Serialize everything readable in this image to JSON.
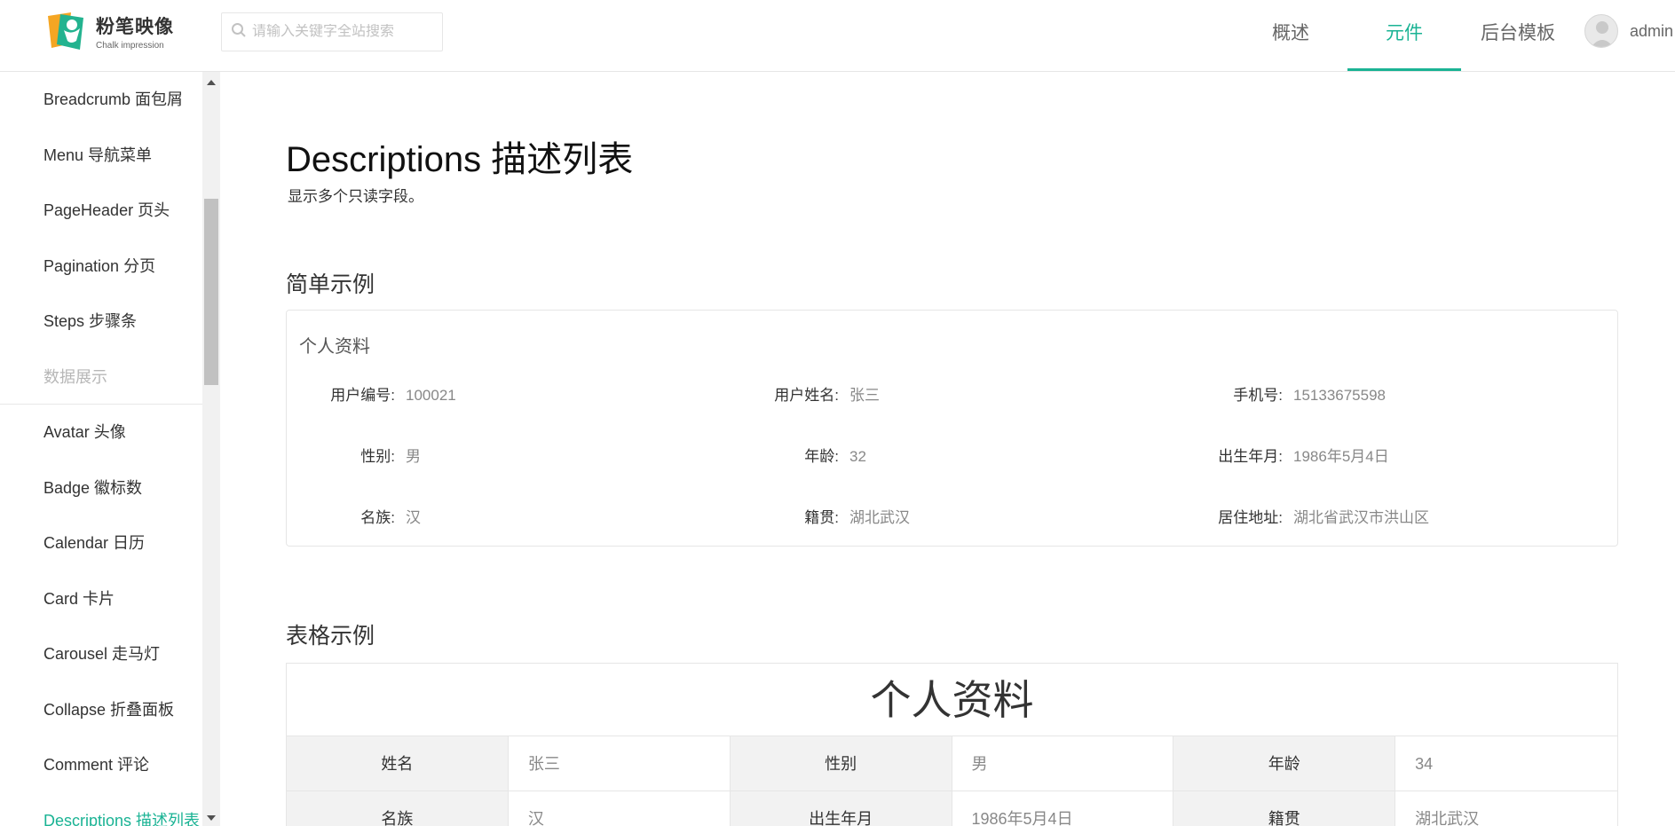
{
  "brand": {
    "title": "粉笔映像",
    "subtitle": "Chalk impression"
  },
  "search": {
    "placeholder": "请输入关键字全站搜索"
  },
  "nav": {
    "items": [
      "概述",
      "元件",
      "后台模板"
    ],
    "active": "元件"
  },
  "user": {
    "name": "admin"
  },
  "sidebar": {
    "items": [
      {
        "label": "Breadcrumb 面包屑"
      },
      {
        "label": "Menu 导航菜单"
      },
      {
        "label": "PageHeader 页头"
      },
      {
        "label": "Pagination 分页"
      },
      {
        "label": "Steps 步骤条"
      },
      {
        "label": "数据展示",
        "group": true
      },
      {
        "label": "Avatar 头像"
      },
      {
        "label": "Badge 徽标数"
      },
      {
        "label": "Calendar 日历"
      },
      {
        "label": "Card 卡片"
      },
      {
        "label": "Carousel 走马灯"
      },
      {
        "label": "Collapse 折叠面板"
      },
      {
        "label": "Comment 评论"
      },
      {
        "label": "Descriptions 描述列表",
        "active": true
      }
    ]
  },
  "page": {
    "title": "Descriptions 描述列表",
    "description": "显示多个只读字段。"
  },
  "simple": {
    "section_title": "简单示例",
    "card_title": "个人资料",
    "rows": [
      [
        {
          "label": "用户编号:",
          "value": "100021"
        },
        {
          "label": "用户姓名:",
          "value": "张三"
        },
        {
          "label": "手机号:",
          "value": "15133675598"
        }
      ],
      [
        {
          "label": "性别:",
          "value": "男"
        },
        {
          "label": "年龄:",
          "value": "32"
        },
        {
          "label": "出生年月:",
          "value": "1986年5月4日"
        }
      ],
      [
        {
          "label": "名族:",
          "value": "汉"
        },
        {
          "label": "籍贯:",
          "value": "湖北武汉"
        },
        {
          "label": "居住地址:",
          "value": "湖北省武汉市洪山区"
        }
      ]
    ]
  },
  "table": {
    "section_title": "表格示例",
    "title": "个人资料",
    "rows": [
      [
        {
          "label": "姓名",
          "value": "张三"
        },
        {
          "label": "性别",
          "value": "男"
        },
        {
          "label": "年龄",
          "value": "34"
        }
      ],
      [
        {
          "label": "名族",
          "value": "汉"
        },
        {
          "label": "出生年月",
          "value": "1986年5月4日"
        },
        {
          "label": "籍贯",
          "value": "湖北武汉"
        }
      ]
    ]
  },
  "colors": {
    "accent": "#1ab394"
  },
  "icons": {
    "search": "search-icon",
    "avatar": "user-avatar-icon"
  }
}
